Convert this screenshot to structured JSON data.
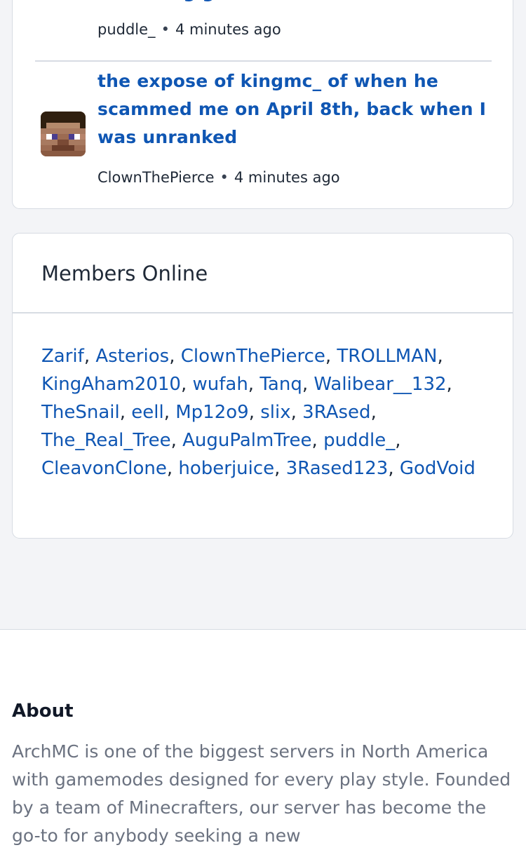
{
  "threads": [
    {
      "title": "rendering glitch?",
      "author": "puddle_",
      "time": "4 minutes ago"
    },
    {
      "title": "the expose of kingmc_ of when he scammed me on April 8th, back when I was unranked",
      "author": "ClownThePierce",
      "time": "4 minutes ago",
      "avatar_icon": "minecraft-steve-avatar"
    }
  ],
  "meta_separator": "•",
  "members_online": {
    "title": "Members Online",
    "members": [
      "Zarif",
      "Asterios",
      "ClownThePierce",
      "TROLLMAN",
      "KingAham2010",
      "wufah",
      "Tanq",
      "Walibear__132",
      "TheSnail",
      "eell",
      "Mp12o9",
      "slix",
      "3RAsed",
      "The_Real_Tree",
      "AuguPalmTree",
      "puddle_",
      "CleavonClone",
      "hoberjuice",
      "3Rased123",
      "GodVoid"
    ]
  },
  "about": {
    "title": "About",
    "text": "ArchMC is one of the biggest servers in North America with gamemodes designed for every play style. Founded by a team of Minecrafters, our server has become the go-to for anybody seeking a new"
  },
  "colors": {
    "link": "#0f56b3",
    "page_bg": "#f3f4f7",
    "border": "#d7dce3",
    "muted_text": "#6b7280"
  }
}
